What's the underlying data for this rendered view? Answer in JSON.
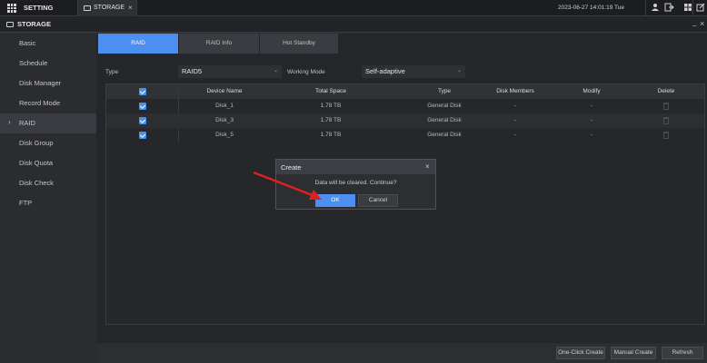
{
  "topbar": {
    "setting_label": "SETTING",
    "tab_label": "STORAGE",
    "tab_close": "×",
    "datetime": "2023-06-27 14:01:19 Tue",
    "icons": [
      "user-icon",
      "logout-icon",
      "grid-view-icon",
      "edit-icon"
    ]
  },
  "subbar": {
    "title": "STORAGE",
    "minimize": "_",
    "close": "×"
  },
  "sidebar": {
    "items": [
      {
        "label": "Basic"
      },
      {
        "label": "Schedule"
      },
      {
        "label": "Disk Manager"
      },
      {
        "label": "Record Mode"
      },
      {
        "label": "RAID"
      },
      {
        "label": "Disk Group"
      },
      {
        "label": "Disk Quota"
      },
      {
        "label": "Disk Check"
      },
      {
        "label": "FTP"
      }
    ],
    "active_arrow": "›"
  },
  "tabs": [
    {
      "label": "RAID"
    },
    {
      "label": "RAID Info"
    },
    {
      "label": "Hot Standby"
    }
  ],
  "form": {
    "type_label": "Type",
    "type_value": "RAID5",
    "mode_label": "Working Mode",
    "mode_value": "Self-adaptive",
    "chevron": "⌄"
  },
  "table": {
    "headers": [
      "",
      "Device Name",
      "Total Space",
      "Type",
      "Disk Members",
      "Modify",
      "Delete"
    ],
    "rows": [
      {
        "device": "Disk_1",
        "space": "1.78 TB",
        "type": "General Disk",
        "members": "-",
        "modify": "-"
      },
      {
        "device": "Disk_3",
        "space": "1.78 TB",
        "type": "General Disk",
        "members": "-",
        "modify": "-"
      },
      {
        "device": "Disk_5",
        "space": "1.78 TB",
        "type": "General Disk",
        "members": "-",
        "modify": "-"
      }
    ]
  },
  "buttons": {
    "one_click": "One-Click Create",
    "manual": "Manual Create",
    "refresh": "Refresh"
  },
  "dialog": {
    "title": "Create",
    "close": "×",
    "message": "Data will be cleared. Continue?",
    "ok": "OK",
    "cancel": "Cancel"
  },
  "colors": {
    "accent": "#4d8ff0",
    "annotation_arrow": "#e02020"
  }
}
